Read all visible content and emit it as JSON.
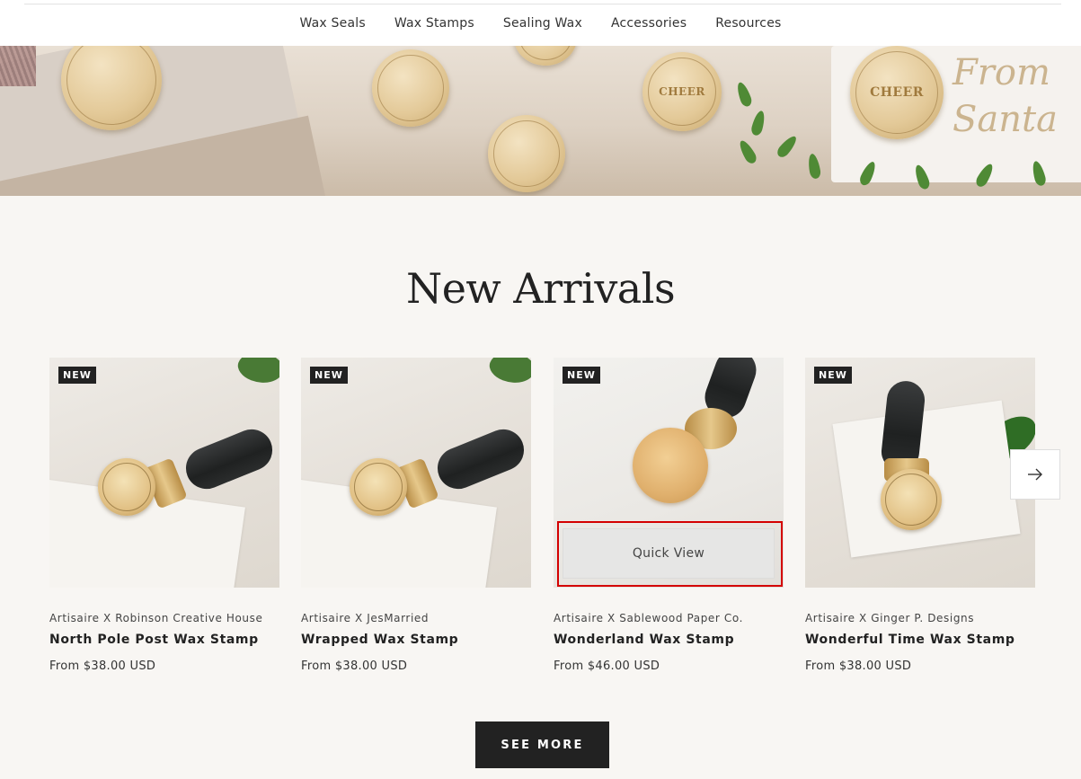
{
  "nav": {
    "items": [
      {
        "label": "Wax Seals"
      },
      {
        "label": "Wax Stamps"
      },
      {
        "label": "Sealing Wax"
      },
      {
        "label": "Accessories"
      },
      {
        "label": "Resources"
      }
    ]
  },
  "hero": {
    "stamp_text": "CHEER",
    "seal_text": "CHEER",
    "script_text": "From Santa"
  },
  "section": {
    "title": "New Arrivals"
  },
  "products": [
    {
      "badge": "NEW",
      "brand": "Artisaire X Robinson Creative House",
      "name": "North Pole Post Wax Stamp",
      "price": "From $38.00 USD"
    },
    {
      "badge": "NEW",
      "brand": "Artisaire X JesMarried",
      "name": "Wrapped Wax Stamp",
      "price": "From $38.00 USD"
    },
    {
      "badge": "NEW",
      "brand": "Artisaire X Sablewood Paper Co.",
      "name": "Wonderland Wax Stamp",
      "price": "From $46.00 USD"
    },
    {
      "badge": "NEW",
      "brand": "Artisaire X Ginger P. Designs",
      "name": "Wonderful Time Wax Stamp",
      "price": "From $38.00 USD"
    }
  ],
  "quick_view": {
    "label": "Quick View"
  },
  "carousel": {
    "next_icon": "arrow-right-icon"
  },
  "see_more": {
    "label": "SEE MORE"
  },
  "colors": {
    "accent_dark": "#222222",
    "highlight_outline": "#d40000",
    "background": "#f8f6f3"
  }
}
